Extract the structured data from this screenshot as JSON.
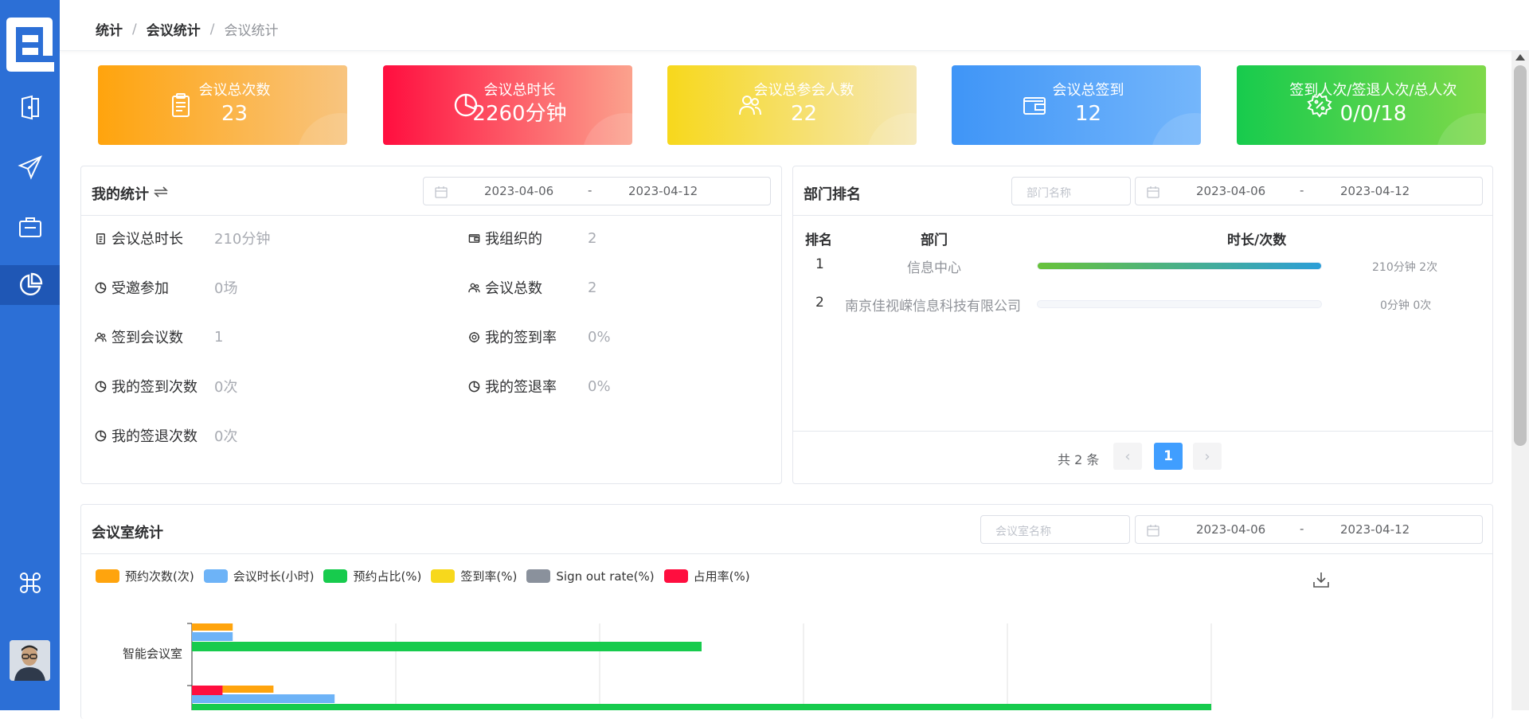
{
  "breadcrumb": [
    "统计",
    "会议统计",
    "会议统计"
  ],
  "breadcrumb_sep": "/",
  "sidebar": {
    "items": [
      {
        "icon": "door-icon"
      },
      {
        "icon": "send-icon"
      },
      {
        "icon": "briefcase-icon"
      },
      {
        "icon": "pie-chart-icon",
        "active": true
      },
      {
        "icon": "command-icon"
      }
    ]
  },
  "cards": [
    {
      "label": "会议总次数",
      "value": "23",
      "icon": "clipboard-icon",
      "color_from": "#ffa40d",
      "color_to": "#f8c47f"
    },
    {
      "label": "会议总时长",
      "value": "2260分钟",
      "icon": "pie-chart-icon",
      "color_from": "#ff0e3f",
      "color_to": "#fba28d"
    },
    {
      "label": "会议总参会人数",
      "value": "22",
      "icon": "users-icon",
      "color_from": "#f7d81c",
      "color_to": "#f5e7b6"
    },
    {
      "label": "会议总签到",
      "value": "12",
      "icon": "wallet-icon",
      "color_from": "#3f95f7",
      "color_to": "#74b6fb"
    },
    {
      "label": "签到人次/签退人次/总人次",
      "value": "0/0/18",
      "icon": "badge-percent-icon",
      "color_from": "#17cb4d",
      "color_to": "#7fd94a"
    }
  ],
  "my_stats": {
    "title": "我的统计",
    "swap_icon": "swap-icon",
    "date_start": "2023-04-06",
    "date_sep": "-",
    "date_end": "2023-04-12",
    "items": [
      {
        "label": "会议总时长",
        "value": "210分钟",
        "icon": "clipboard-icon"
      },
      {
        "label": "我组织的",
        "value": "2",
        "icon": "wallet-icon"
      },
      {
        "label": "受邀参加",
        "value": "0场",
        "icon": "pie-chart-icon"
      },
      {
        "label": "会议总数",
        "value": "2",
        "icon": "users-icon"
      },
      {
        "label": "签到会议数",
        "value": "1",
        "icon": "users-icon"
      },
      {
        "label": "我的签到率",
        "value": "0%",
        "icon": "gear-icon"
      },
      {
        "label": "我的签到次数",
        "value": "0次",
        "icon": "pie-chart-icon"
      },
      {
        "label": "我的签退率",
        "value": "0%",
        "icon": "pie-chart-icon"
      },
      {
        "label": "我的签退次数",
        "value": "0次",
        "icon": "pie-chart-icon"
      }
    ]
  },
  "dept_rank": {
    "title": "部门排名",
    "dept_placeholder": "部门名称",
    "date_start": "2023-04-06",
    "date_sep": "-",
    "date_end": "2023-04-12",
    "headers": [
      "排名",
      "部门",
      "时长/次数"
    ],
    "rows": [
      {
        "rank": "1",
        "dept": "信息中心",
        "stat": "210分钟 2次",
        "progress": 1.0
      },
      {
        "rank": "2",
        "dept": "南京佳视嵘信息科技有限公司",
        "stat": "0分钟 0次",
        "progress": 0.0
      }
    ],
    "total_text": "共 2 条",
    "current_page": "1",
    "prev": "‹",
    "next": "›"
  },
  "room_stats": {
    "title": "会议室统计",
    "room_placeholder": "会议室名称",
    "date_start": "2023-04-06",
    "date_sep": "-",
    "date_end": "2023-04-12",
    "download_icon": "download-icon"
  },
  "chart_data": {
    "type": "bar",
    "orientation": "horizontal",
    "legend": [
      "预约次数(次)",
      "会议时长(小时)",
      "预约占比(%)",
      "签到率(%)",
      "Sign out rate(%)",
      "占用率(%)"
    ],
    "legend_colors": [
      "#ffa40d",
      "#6db3f7",
      "#17cb4d",
      "#f7d81c",
      "#8a919c",
      "#ff0e3f"
    ],
    "legend_placement": "top-left",
    "grid": true,
    "categories": [
      "智能会议室",
      ""
    ],
    "series": [
      {
        "name": "预约次数(次)",
        "values": [
          2,
          4
        ]
      },
      {
        "name": "会议时长(小时)",
        "values": [
          2,
          7
        ]
      },
      {
        "name": "预约占比(%)",
        "values": [
          25,
          50
        ]
      },
      {
        "name": "签到率(%)",
        "values": [
          0,
          0
        ]
      },
      {
        "name": "Sign out rate(%)",
        "values": [
          0,
          0
        ]
      },
      {
        "name": "占用率(%)",
        "values": [
          0,
          1.5
        ]
      }
    ],
    "xlim": [
      0,
      50
    ]
  },
  "colors": {
    "sidebar": "#2c6fd6",
    "accent": "#409eff"
  }
}
